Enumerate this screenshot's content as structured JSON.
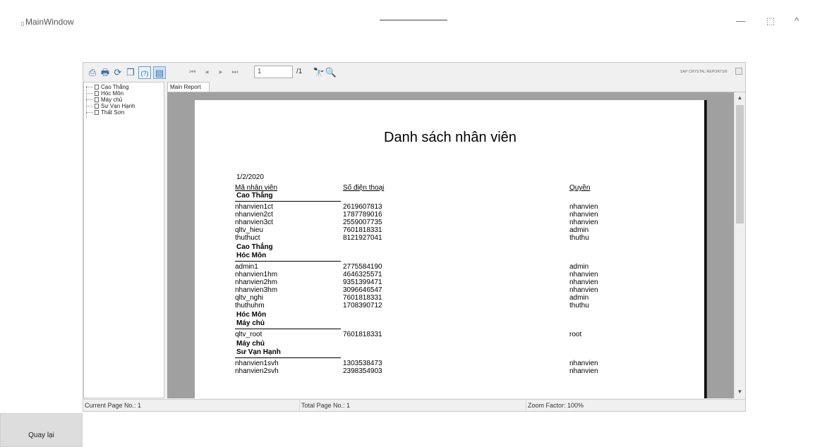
{
  "window": {
    "title": "MainWindow",
    "controls": {
      "minimize": "—",
      "maximize": "⬚",
      "collapse": "^"
    }
  },
  "toolbar": {
    "page_input": "1",
    "page_total": "/1",
    "brand": "SAP CRYSTAL REPORTS®",
    "icons": [
      "export-icon",
      "print-icon",
      "refresh-icon",
      "copy-icon",
      "help-icon",
      "group-tree-icon",
      "first-page-icon",
      "previous-page-icon",
      "next-page-icon",
      "last-page-icon",
      "find-icon",
      "zoom-icon"
    ]
  },
  "tree": {
    "items": [
      "Cao Thắng",
      "Hóc Môn",
      "Máy chủ",
      "Sư Vạn Hạnh",
      "Thất Sơn"
    ]
  },
  "tab": {
    "label": "Main Report"
  },
  "report": {
    "title": "Danh sách nhân viên",
    "date": "1/2/2020",
    "columns": [
      "Mã nhân viên",
      "Số điện thoại",
      "Quyền"
    ],
    "groups": [
      {
        "name": "Cao Thắng",
        "rows": [
          [
            "nhanvien1ct",
            "2619607813",
            "nhanvien"
          ],
          [
            "nhanvien2ct",
            "1787789016",
            "nhanvien"
          ],
          [
            "nhanvien3ct",
            "2559007735",
            "nhanvien"
          ],
          [
            "qltv_hieu",
            "7601818331",
            "admin"
          ],
          [
            "thuthuct",
            "8121927041",
            "thuthu"
          ]
        ],
        "footer": "Cao Thắng"
      },
      {
        "name": "Hóc Môn",
        "rows": [
          [
            "admin1",
            "2775584190",
            "admin"
          ],
          [
            "nhanvien1hm",
            "4646325571",
            "nhanvien"
          ],
          [
            "nhanvien2hm",
            "9351399471",
            "nhanvien"
          ],
          [
            "nhanvien3hm",
            "3096646547",
            "nhanvien"
          ],
          [
            "qltv_nghi",
            "7601818331",
            "admin"
          ],
          [
            "thuthuhm",
            "1708390712",
            "thuthu"
          ]
        ],
        "footer": "Hóc Môn"
      },
      {
        "name": "Máy chủ",
        "rows": [
          [
            "qltv_root",
            "7601818331",
            "root"
          ]
        ],
        "footer": "Máy chủ"
      },
      {
        "name": "Sư Vạn Hạnh",
        "rows": [
          [
            "nhanvien1svh",
            "1303538473",
            "nhanvien"
          ],
          [
            "nhanvien2svh",
            "2398354903",
            "nhanvien"
          ]
        ]
      }
    ]
  },
  "status": {
    "current_page": "Current Page No.: 1",
    "total_page": "Total Page No.: 1",
    "zoom": "Zoom Factor: 100%"
  },
  "back_button": {
    "label": "Quay lại"
  }
}
